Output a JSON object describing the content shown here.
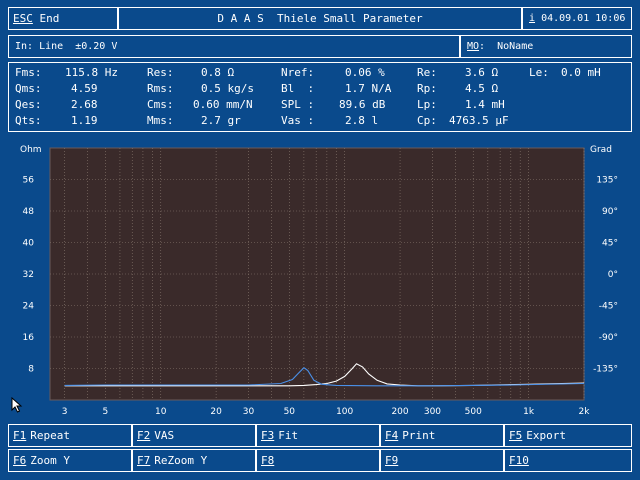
{
  "topbar": {
    "esc_key": "ESC",
    "esc_label": "End",
    "title": "D A A S  Thiele Small Parameter",
    "info_key": "i",
    "date": "04.09.01",
    "time": "10:06"
  },
  "inputbar": {
    "input_label": "In: Line  ±0.20 V",
    "mo_key": "MO",
    "mo_label": ":  NoName"
  },
  "params": {
    "col1": [
      {
        "label": "Fms:",
        "value": "115.8 Hz"
      },
      {
        "label": "Qms:",
        "value": "4.59"
      },
      {
        "label": "Qes:",
        "value": "2.68"
      },
      {
        "label": "Qts:",
        "value": "1.19"
      }
    ],
    "col2": [
      {
        "label": "Res:",
        "value": "0.8 Ω"
      },
      {
        "label": "Rms:",
        "value": "0.5 kg/s"
      },
      {
        "label": "Cms:",
        "value": "0.60 mm/N"
      },
      {
        "label": "Mms:",
        "value": "2.7 gr"
      }
    ],
    "col3": [
      {
        "label": "Nref:",
        "value": "0.06 %"
      },
      {
        "label": "Bl  :",
        "value": "1.7 N/A"
      },
      {
        "label": "SPL :",
        "value": "89.6 dB"
      },
      {
        "label": "Vas :",
        "value": "2.8 l"
      }
    ],
    "col4": [
      {
        "label": "Re:",
        "value": "3.6 Ω"
      },
      {
        "label": "Rp:",
        "value": "4.5 Ω"
      },
      {
        "label": "Lp:",
        "value": "1.4 mH"
      },
      {
        "label": "Cp:",
        "value": "4763.5 µF"
      }
    ],
    "le": {
      "label": "Le:",
      "value": "0.0 mH"
    }
  },
  "chart_data": {
    "type": "line",
    "xscale": "log",
    "xlim": [
      2.5,
      2000
    ],
    "ylim": [
      0,
      64
    ],
    "y2lim": [
      -180,
      180
    ],
    "ylabel": "Ohm",
    "y2label": "Grad",
    "x_ticks": [
      3,
      5,
      10,
      20,
      30,
      50,
      100,
      200,
      300,
      500,
      1000,
      2000
    ],
    "x_tick_labels": [
      "3",
      "5",
      "10",
      "20",
      "30",
      "50",
      "100",
      "200",
      "300",
      "500",
      "1k",
      "2k"
    ],
    "y_ticks": [
      8,
      16,
      24,
      32,
      40,
      48,
      56
    ],
    "y2_ticks": [
      -135,
      -90,
      -45,
      0,
      45,
      90,
      135
    ],
    "y2_tick_labels": [
      "-135°",
      "-90°",
      "-45°",
      "0°",
      "45°",
      "90°",
      "135°"
    ],
    "grid": true,
    "series": [
      {
        "axis": "left",
        "color": "#ffffff",
        "x": [
          3,
          5,
          10,
          20,
          30,
          40,
          50,
          60,
          70,
          80,
          90,
          100,
          110,
          116,
          125,
          135,
          150,
          170,
          200,
          250,
          300,
          500,
          1000,
          2000
        ],
        "y": [
          3.6,
          3.6,
          3.6,
          3.6,
          3.6,
          3.6,
          3.6,
          3.7,
          3.9,
          4.2,
          4.8,
          6.0,
          8.0,
          9.2,
          8.4,
          6.6,
          5.0,
          4.1,
          3.8,
          3.6,
          3.6,
          3.7,
          4.0,
          4.3
        ]
      },
      {
        "axis": "left",
        "color": "#4a90e8",
        "x": [
          3,
          5,
          10,
          20,
          30,
          45,
          52,
          56,
          60,
          63,
          68,
          75,
          90,
          150,
          300,
          800,
          2000
        ],
        "y": [
          3.7,
          3.8,
          3.8,
          3.8,
          3.8,
          4.2,
          5.2,
          6.8,
          8.2,
          7.5,
          5.0,
          4.0,
          3.7,
          3.6,
          3.6,
          3.8,
          4.2
        ]
      }
    ]
  },
  "fkeys": [
    {
      "key": "F1",
      "label": "Repeat"
    },
    {
      "key": "F2",
      "label": "VAS"
    },
    {
      "key": "F3",
      "label": "Fit"
    },
    {
      "key": "F4",
      "label": "Print"
    },
    {
      "key": "F5",
      "label": "Export"
    },
    {
      "key": "F6",
      "label": "Zoom Y"
    },
    {
      "key": "F7",
      "label": "ReZoom Y"
    },
    {
      "key": "F8",
      "label": ""
    },
    {
      "key": "F9",
      "label": ""
    },
    {
      "key": "F10",
      "label": ""
    }
  ]
}
